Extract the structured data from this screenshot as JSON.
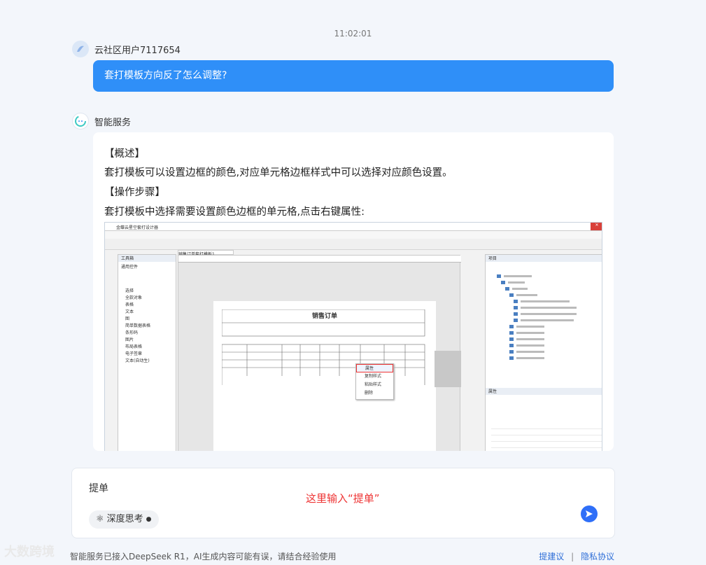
{
  "time": "11:02:01",
  "user": {
    "name": "云社区用户7117654",
    "message": "套打模板方向反了怎么调整?"
  },
  "bot": {
    "name": "智能服务",
    "overview_heading": "【概述】",
    "overview_text": "套打模板可以设置边框的颜色,对应单元格边框样式中可以选择对应颜色设置。",
    "steps_heading": "【操作步骤】",
    "steps_text": "套打模板中选择需要设置颜色边框的单元格,点击右键属性:"
  },
  "screenshot": {
    "window_title": "金蝶云星空套打设计器",
    "tab": "销售订单套打模板1",
    "toolbox": "工具箱",
    "common": "通用控件",
    "tools": [
      "选择",
      "全款对象",
      "表格",
      "文本",
      "图",
      "简单数据表格",
      "条形码",
      "图片",
      "布局表格",
      "电子签章",
      "文本(自动生)"
    ],
    "order_title": "销售订单",
    "project_panel": "项目",
    "property_panel": "属性",
    "context_menu": [
      "属性",
      "复制样式",
      "粘贴样式",
      "删除"
    ]
  },
  "input": {
    "value": "提单",
    "hint": "这里输入“提单”",
    "deep_think": "深度思考"
  },
  "footer": {
    "text": "智能服务已接入DeepSeek R1，AI生成内容可能有误，请结合经验使用",
    "suggest": "提建议",
    "privacy": "隐私协议"
  },
  "watermark": "大数跨境",
  "colors": {
    "accent": "#2f8ff8",
    "hint": "#e33333",
    "link": "#2f6fd8"
  }
}
